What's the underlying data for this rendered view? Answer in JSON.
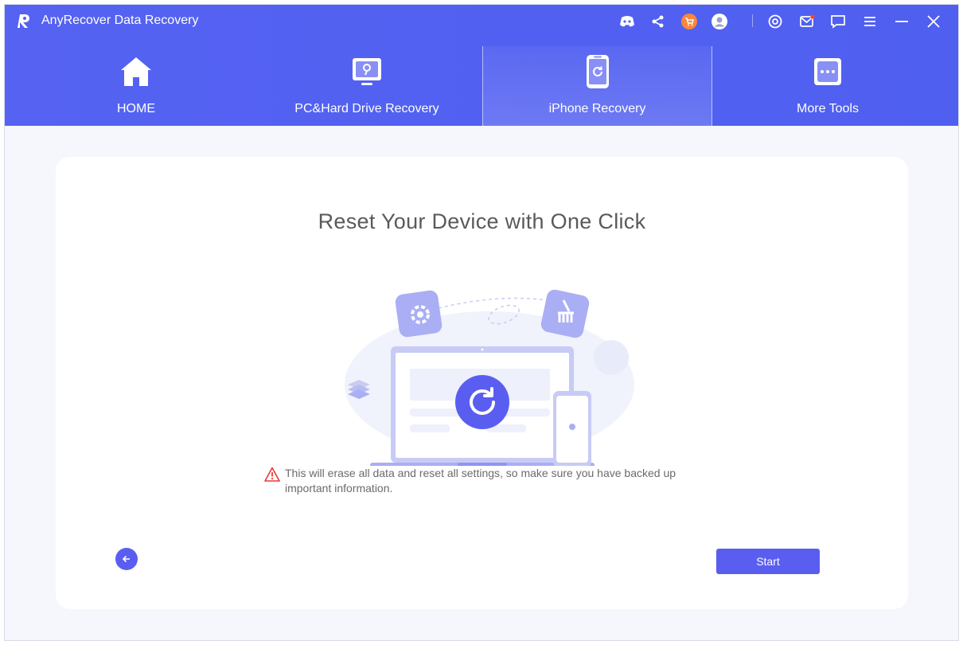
{
  "app": {
    "title": "AnyRecover Data Recovery"
  },
  "titlebar": {
    "icons": [
      "discord-icon",
      "share-icon",
      "cart-icon",
      "account-icon",
      "settings-icon",
      "mail-icon",
      "feedback-icon",
      "menu-icon",
      "minimize-icon",
      "close-icon"
    ],
    "cart_badge_color": "#f7873b"
  },
  "nav": {
    "tabs": [
      {
        "label": "HOME",
        "icon": "home-icon"
      },
      {
        "label": "PC&Hard Drive Recovery",
        "icon": "hard-drive-icon"
      },
      {
        "label": "iPhone Recovery",
        "icon": "iphone-icon",
        "active": true
      },
      {
        "label": "More Tools",
        "icon": "more-tools-icon"
      }
    ]
  },
  "main": {
    "title": "Reset Your Device with One Click",
    "warning": "This will erase all data and reset all settings, so make sure you have backed up important information.",
    "start_label": "Start"
  },
  "colors": {
    "accent": "#5a5ef0",
    "header": "#5562f2",
    "warning": "#e53935"
  }
}
